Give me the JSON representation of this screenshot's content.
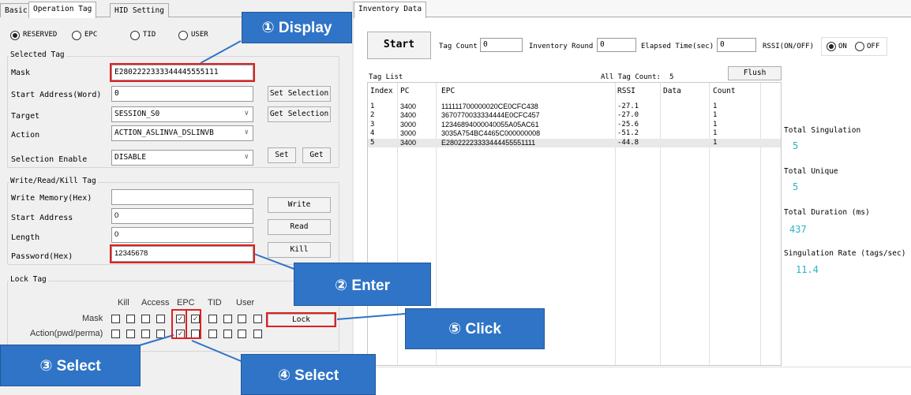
{
  "tabs": {
    "basic": "Basic",
    "operation_tag": "Operation Tag",
    "hid_setting": "HID Setting",
    "inventory_data": "Inventory Data"
  },
  "bank_radios": {
    "reserved": "RESERVED",
    "epc": "EPC",
    "tid": "TID",
    "user": "USER",
    "selected": "RESERVED"
  },
  "selected_tag": {
    "title": "Selected Tag",
    "mask_label": "Mask",
    "mask_value": "E2802222333344445555111",
    "start_address_label": "Start Address(Word)",
    "start_address_value": "0",
    "target_label": "Target",
    "target_value": "SESSION_S0",
    "action_label": "Action",
    "action_value": "ACTION_ASLINVA_DSLINVB",
    "selection_enable_label": "Selection Enable",
    "selection_enable_value": "DISABLE",
    "set_selection": "Set Selection",
    "get_selection": "Get Selection",
    "set": "Set",
    "get": "Get"
  },
  "write_tag": {
    "title": "Write/Read/Kill Tag",
    "write_memory_label": "Write Memory(Hex)",
    "write_memory_value": "",
    "start_address_label": "Start Address",
    "start_address_value": "0",
    "length_label": "Length",
    "length_value": "0",
    "password_label": "Password(Hex)",
    "password_value": "12345678",
    "write": "Write",
    "read": "Read",
    "kill": "Kill"
  },
  "lock_tag": {
    "title": "Lock Tag",
    "columns": [
      "Kill",
      "Access",
      "EPC",
      "TID",
      "User"
    ],
    "mask_label": "Mask",
    "action_label": "Action(pwd/perma)",
    "mask_checks": [
      false,
      false,
      false,
      false,
      true,
      true,
      false,
      false,
      false,
      false
    ],
    "action_checks": [
      false,
      false,
      false,
      false,
      true,
      false,
      false,
      false,
      false,
      false
    ],
    "lock": "Lock"
  },
  "inventory": {
    "start": "Start",
    "tag_count_label": "Tag Count",
    "tag_count_value": "0",
    "inventory_round_label": "Inventory Round",
    "inventory_round_value": "0",
    "elapsed_label": "Elapsed Time(sec)",
    "elapsed_value": "0",
    "rssi_label": "RSSI(ON/OFF)",
    "rssi_on": "ON",
    "rssi_off": "OFF",
    "rssi_selected": "ON",
    "tag_list_label": "Tag List",
    "all_tag_count_label": "All Tag Count:",
    "all_tag_count_value": "5",
    "flush": "Flush",
    "columns": [
      "Index",
      "PC",
      "EPC",
      "RSSI",
      "Data",
      "Count"
    ],
    "rows": [
      [
        "1",
        "3400",
        "111111700000020CE0CFC438",
        "-27.1",
        "",
        "1"
      ],
      [
        "2",
        "3400",
        "3670770033334444E0CFC457",
        "-27.0",
        "",
        "1"
      ],
      [
        "3",
        "3000",
        "12346894000040055A05AC61",
        "-25.6",
        "",
        "1"
      ],
      [
        "4",
        "3000",
        "3035A754BC4465C000000008",
        "-51.2",
        "",
        "1"
      ],
      [
        "5",
        "3400",
        "E28022223333444455551111",
        "-44.8",
        "",
        "1"
      ]
    ]
  },
  "stats": {
    "total_singulation_label": "Total Singulation",
    "total_singulation_value": "5",
    "total_unique_label": "Total Unique",
    "total_unique_value": "5",
    "total_duration_label": "Total Duration (ms)",
    "total_duration_value": "437",
    "singulation_rate_label": "Singulation Rate (tags/sec)",
    "singulation_rate_value": "11.4"
  },
  "callouts": {
    "display": "① Display",
    "enter": "② Enter",
    "select3": "③ Select",
    "select4": "④ Select",
    "click": "⑤ Click"
  },
  "colors": {
    "callout_bg": "#2f74c6",
    "highlight": "#e02020",
    "stat_value": "#2cb2c4"
  }
}
